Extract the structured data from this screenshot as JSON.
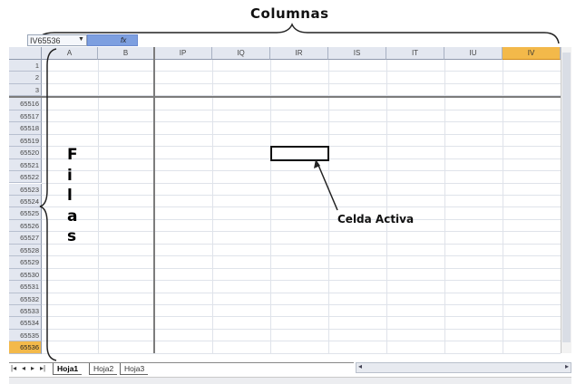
{
  "annotations": {
    "columns_title": "Columnas",
    "rows_letters": [
      "F",
      "i",
      "l",
      "a",
      "s"
    ],
    "active_cell_label": "Celda Activa"
  },
  "toolbar": {
    "name_box_value": "IV65536",
    "fx_label": "fx"
  },
  "columns": [
    "A",
    "B",
    "IP",
    "IQ",
    "IR",
    "IS",
    "IT",
    "IU",
    "IV"
  ],
  "selected_column": "IV",
  "rows": [
    "1",
    "2",
    "3",
    "65516",
    "65517",
    "65518",
    "65519",
    "65520",
    "65521",
    "65522",
    "65523",
    "65524",
    "65525",
    "65526",
    "65527",
    "65528",
    "65529",
    "65530",
    "65531",
    "65532",
    "65533",
    "65534",
    "65535",
    "65536"
  ],
  "selected_row": "65536",
  "active_cell": {
    "column": "IR",
    "row": "65520"
  },
  "sheet_tabs": [
    {
      "label": "Hoja1",
      "active": true
    },
    {
      "label": "Hoja2",
      "active": false
    },
    {
      "label": "Hoja3",
      "active": false
    }
  ],
  "nav_buttons": [
    "|◂",
    "◂",
    "▸",
    "▸|"
  ],
  "colors": {
    "header_bg": "#e3e7f0",
    "selected_header": "#f3b94a",
    "fx_bar": "#7d9fe0"
  }
}
